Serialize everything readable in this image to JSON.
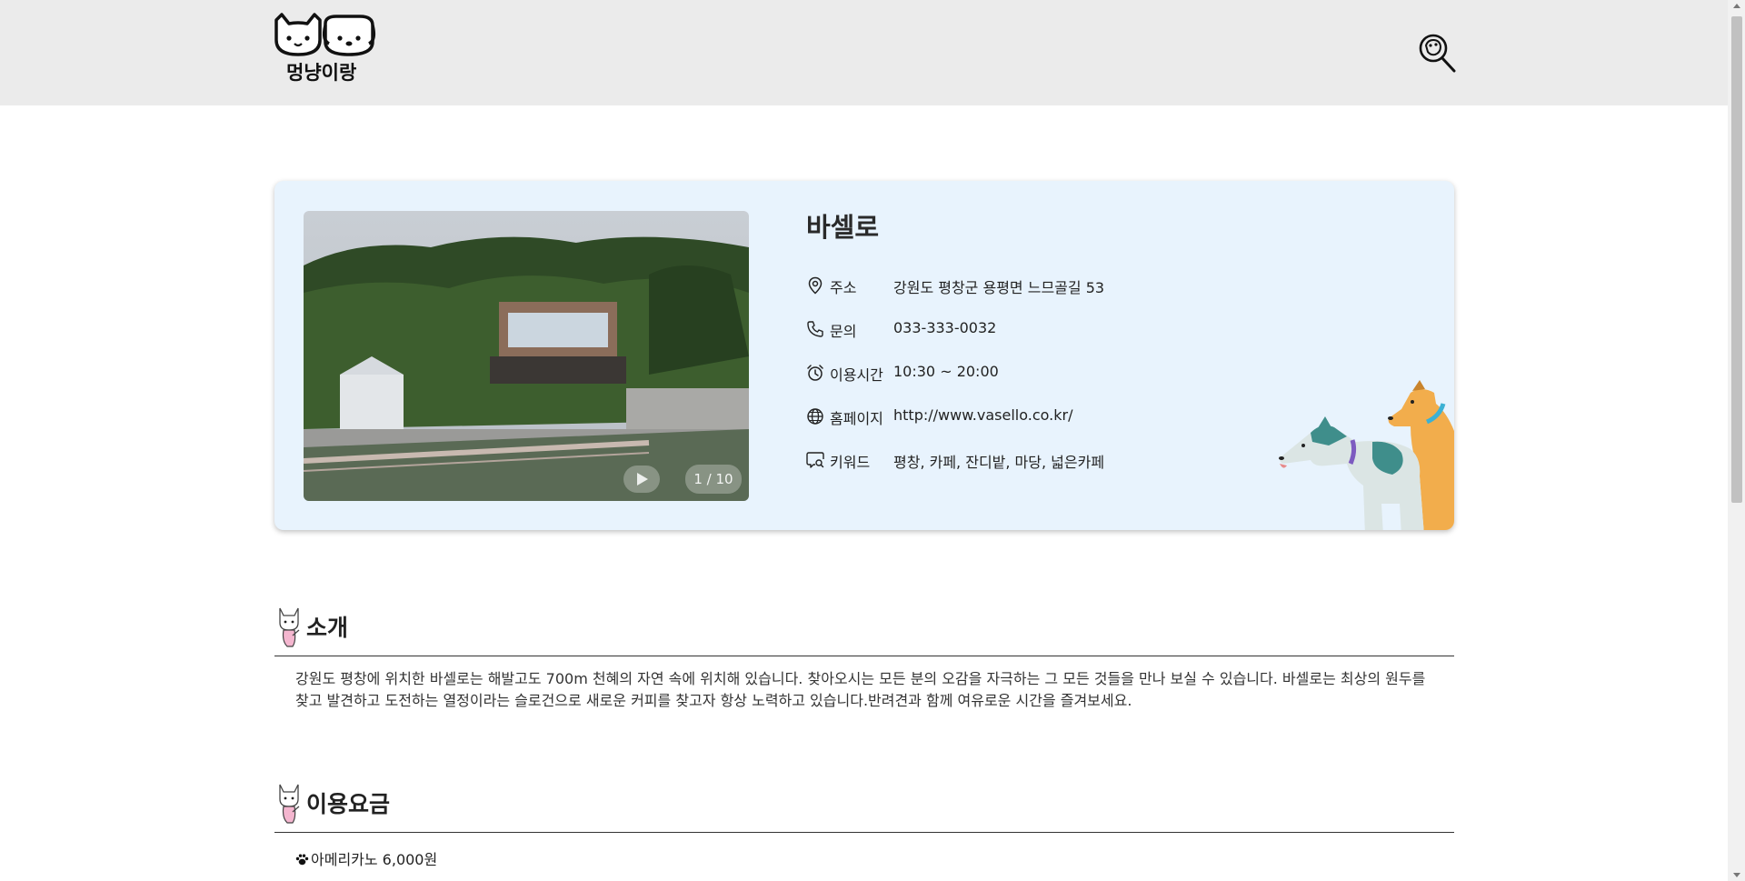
{
  "header": {
    "logo_text": "멍냥이랑",
    "search_icon": "search-paw-icon"
  },
  "detail": {
    "title": "바셀로",
    "photo_counter": "1 / 10",
    "rows": [
      {
        "icon": "location-pin-icon",
        "label": "주소",
        "value": "강원도 평창군 용평면 느므골길 53"
      },
      {
        "icon": "phone-icon",
        "label": "문의",
        "value": "033-333-0032"
      },
      {
        "icon": "alarm-clock-icon",
        "label": "이용시간",
        "value": "10:30 ~ 20:00"
      },
      {
        "icon": "globe-icon",
        "label": "홈페이지",
        "value": "http://www.vasello.co.kr/"
      },
      {
        "icon": "chat-search-icon",
        "label": "키워드",
        "value": "평창, 카페, 잔디밭, 마당, 넓은카페"
      }
    ]
  },
  "sections": {
    "intro": {
      "title": "소개",
      "text": "강원도 평창에 위치한 바셀로는 해발고도 700m 천혜의 자연 속에 위치해 있습니다. 찾아오시는 모든 분의 오감을 자극하는 그 모든 것들을 만나 보실 수 있습니다. 바셀로는 최상의 원두를 찾고 발견하고 도전하는 열정이라는 슬로건으로 새로운 커피를 찾고자 항상 노력하고 있습니다.반려견과 함께 여유로운 시간을 즐겨보세요."
    },
    "pricing": {
      "title": "이용요금",
      "items": [
        "아메리카노 6,000원"
      ]
    }
  },
  "colors": {
    "header_bg": "#ebebeb",
    "card_bg": "#e8f3fd",
    "text": "#222222"
  }
}
